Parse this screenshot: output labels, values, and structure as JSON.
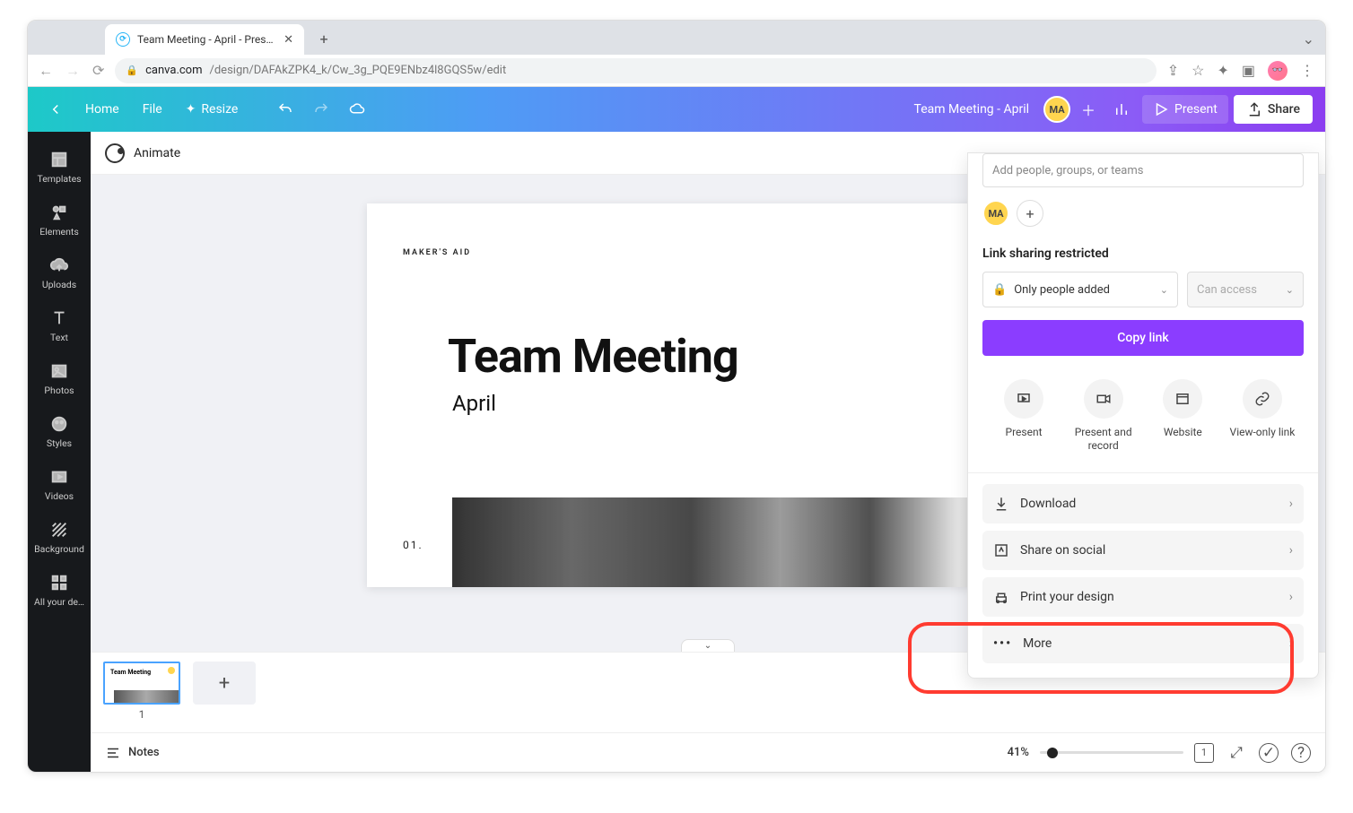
{
  "browser": {
    "tab_title": "Team Meeting - April - Present",
    "url_domain": "canva.com",
    "url_path": "/design/DAFAkZPK4_k/Cw_3g_PQE9ENbz4l8GQS5w/edit"
  },
  "header": {
    "home": "Home",
    "file": "File",
    "resize": "Resize",
    "doc_title": "Team Meeting - April",
    "avatar_initials": "MA",
    "present": "Present",
    "share": "Share"
  },
  "context_bar": {
    "animate": "Animate"
  },
  "sidebar": {
    "items": [
      {
        "label": "Templates"
      },
      {
        "label": "Elements"
      },
      {
        "label": "Uploads"
      },
      {
        "label": "Text"
      },
      {
        "label": "Photos"
      },
      {
        "label": "Styles"
      },
      {
        "label": "Videos"
      },
      {
        "label": "Background"
      },
      {
        "label": "All your de…"
      }
    ]
  },
  "slide": {
    "maker": "MAKER'S AID",
    "title": "Team Meeting",
    "subtitle": "April",
    "page_num": "01."
  },
  "thumbs": {
    "number": "1",
    "title": "Team Meeting"
  },
  "bottom": {
    "notes": "Notes",
    "zoom": "41%"
  },
  "share_panel": {
    "input_placeholder": "Add people, groups, or teams",
    "avatar_initials": "MA",
    "link_status": "Link sharing restricted",
    "perm_selected": "Only people added",
    "perm_access": "Can access",
    "copy": "Copy link",
    "ico_present": "Present",
    "ico_record": "Present and record",
    "ico_website": "Website",
    "ico_viewlink": "View-only link",
    "download": "Download",
    "social": "Share on social",
    "print": "Print your design",
    "more": "More"
  }
}
